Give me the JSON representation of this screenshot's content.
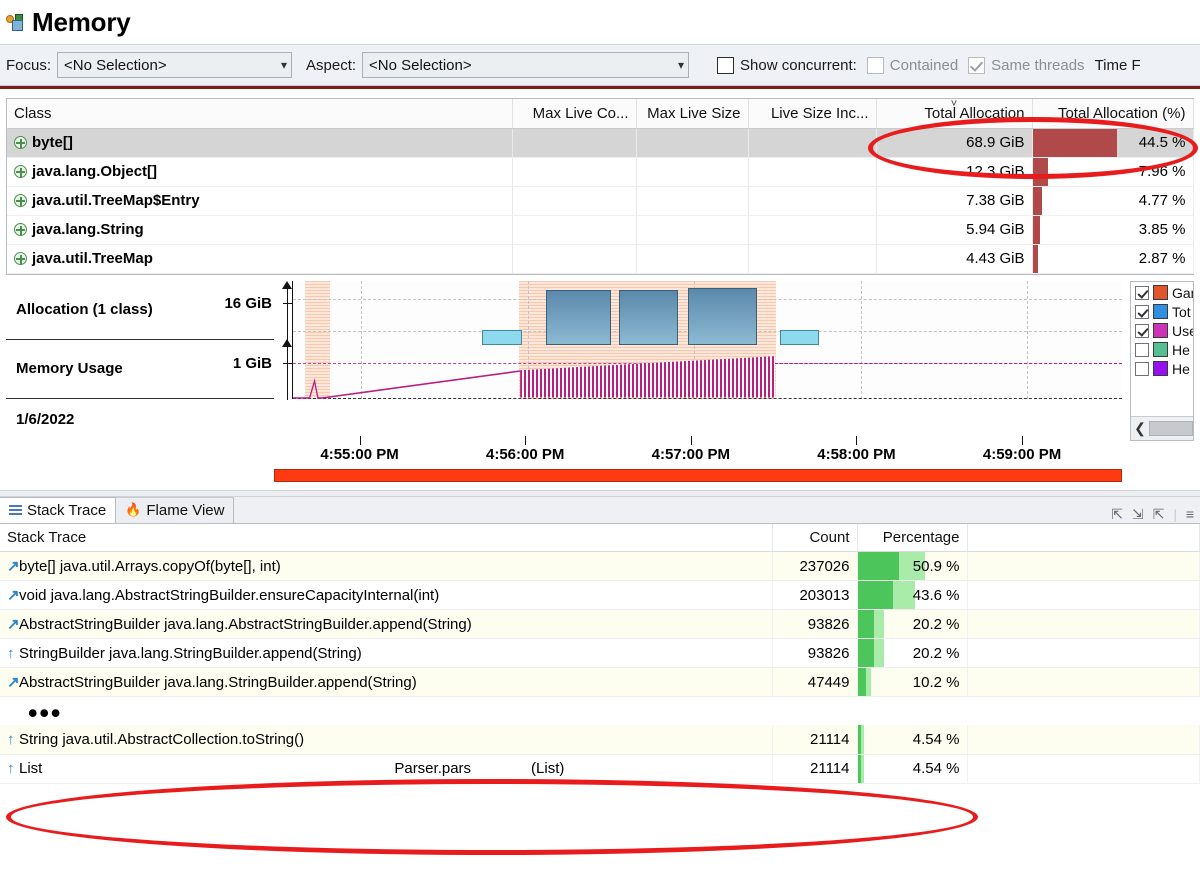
{
  "header": {
    "title": "Memory",
    "icon": "memory-icon"
  },
  "toolbar": {
    "focus_label": "Focus:",
    "focus_value": "<No Selection>",
    "aspect_label": "Aspect:",
    "aspect_value": "<No Selection>",
    "show_concurrent_label": "Show concurrent:",
    "contained_label": "Contained",
    "same_threads_label": "Same threads",
    "trailing_label": "Time F",
    "show_concurrent_checked": false,
    "contained_checked": false,
    "same_threads_checked": true
  },
  "class_table": {
    "columns": [
      "Class",
      "Max Live Co...",
      "Max Live Size",
      "Live Size Inc...",
      "Total Allocation",
      "Total Allocation (%)"
    ],
    "sorted_column": "Total Allocation",
    "sort_indicator": "˅",
    "rows": [
      {
        "class": "byte[]",
        "max_live_count": "",
        "max_live_size": "",
        "live_size_inc": "",
        "total_allocation": "68.9 GiB",
        "total_allocation_pct": "44.5 %",
        "pct_value": 44.5,
        "selected": true
      },
      {
        "class": "java.lang.Object[]",
        "max_live_count": "",
        "max_live_size": "",
        "live_size_inc": "",
        "total_allocation": "12.3 GiB",
        "total_allocation_pct": "7.96 %",
        "pct_value": 7.96,
        "selected": false
      },
      {
        "class": "java.util.TreeMap$Entry",
        "max_live_count": "",
        "max_live_size": "",
        "live_size_inc": "",
        "total_allocation": "7.38 GiB",
        "total_allocation_pct": "4.77 %",
        "pct_value": 4.77,
        "selected": false
      },
      {
        "class": "java.lang.String",
        "max_live_count": "",
        "max_live_size": "",
        "live_size_inc": "",
        "total_allocation": "5.94 GiB",
        "total_allocation_pct": "3.85 %",
        "pct_value": 3.85,
        "selected": false
      },
      {
        "class": "java.util.TreeMap",
        "max_live_count": "",
        "max_live_size": "",
        "live_size_inc": "",
        "total_allocation": "4.43 GiB",
        "total_allocation_pct": "2.87 %",
        "pct_value": 2.87,
        "selected": false
      }
    ]
  },
  "chart_data": {
    "type": "area",
    "title": "",
    "lanes": [
      {
        "label": "Allocation (1 class)",
        "axis_max_label": "16 GiB"
      },
      {
        "label": "Memory Usage",
        "axis_max_label": "1 GiB"
      }
    ],
    "date_label": "1/6/2022",
    "xlabel": "",
    "x_tick_labels": [
      "4:55:00 PM",
      "4:56:00 PM",
      "4:57:00 PM",
      "4:58:00 PM",
      "4:59:00 PM"
    ],
    "x_tick_positions_pct": [
      8.2,
      28.3,
      48.4,
      68.5,
      88.6
    ],
    "ylabels": [
      "16 GiB",
      "1 GiB"
    ],
    "grid": true,
    "selection_regions": [
      {
        "start_pct": 1.5,
        "end_pct": 4.5
      },
      {
        "start_pct": 27.3,
        "end_pct": 58.3
      }
    ],
    "allocation_boxes": [
      {
        "start_pct": 22.8,
        "end_pct": 27.6,
        "top_pct": 42,
        "height_pct": 13,
        "color": "#8fd9ee"
      },
      {
        "start_pct": 30.5,
        "end_pct": 38.3,
        "top_pct": 8,
        "height_pct": 47,
        "color": "#6d9cbd"
      },
      {
        "start_pct": 39.3,
        "end_pct": 46.5,
        "top_pct": 8,
        "height_pct": 47,
        "color": "#6d9cbd"
      },
      {
        "start_pct": 47.6,
        "end_pct": 56.0,
        "top_pct": 6,
        "height_pct": 49,
        "color": "#6d9cbd"
      },
      {
        "start_pct": 58.8,
        "end_pct": 63.5,
        "top_pct": 42,
        "height_pct": 13,
        "color": "#8fd9ee"
      }
    ],
    "memory_series_color": "#b81f80",
    "memory_ramp_start_pct": 3.5,
    "memory_ramp_end_pct": 27.4,
    "memory_oscillation_start_pct": 27.4,
    "memory_oscillation_end_pct": 58.2,
    "memory_plateau_pct": 32
  },
  "legend": {
    "items": [
      {
        "label": "Gar",
        "color": "#e0552a",
        "checked": true
      },
      {
        "label": "Tot",
        "color": "#2f8fe0",
        "checked": true
      },
      {
        "label": "Use",
        "color": "#cc34b8",
        "checked": true
      },
      {
        "label": "He",
        "color": "#57bd92",
        "checked": false
      },
      {
        "label": "He",
        "color": "#9610f0",
        "checked": false
      }
    ],
    "scroll_left_icon": "chevron-left-icon"
  },
  "bottom_panel": {
    "tabs": [
      {
        "label": "Stack Trace",
        "icon": "list-icon",
        "active": true
      },
      {
        "label": "Flame View",
        "icon": "flame-icon",
        "active": false
      }
    ],
    "tools": [
      "collapse-icon",
      "expand-icon",
      "collapse-all-icon",
      "tree-icon"
    ],
    "columns": [
      "Stack Trace",
      "Count",
      "Percentage"
    ],
    "rows": [
      {
        "icon": "branch-arrow-icon",
        "trace": "byte[] java.util.Arrays.copyOf(byte[], int)",
        "count": "237026",
        "percentage": "50.9 %",
        "pct_value": 50.9,
        "tint": true
      },
      {
        "icon": "branch-arrow-icon",
        "trace": "void java.lang.AbstractStringBuilder.ensureCapacityInternal(int)",
        "count": "203013",
        "percentage": "43.6 %",
        "pct_value": 43.6,
        "tint": false
      },
      {
        "icon": "branch-arrow-icon",
        "trace": "AbstractStringBuilder java.lang.AbstractStringBuilder.append(String)",
        "count": "93826",
        "percentage": "20.2 %",
        "pct_value": 20.2,
        "tint": true
      },
      {
        "icon": "up-arrow-icon",
        "trace": "StringBuilder java.lang.StringBuilder.append(String)",
        "count": "93826",
        "percentage": "20.2 %",
        "pct_value": 20.2,
        "tint": false
      },
      {
        "icon": "branch-arrow-icon",
        "trace": "AbstractStringBuilder java.lang.StringBuilder.append(String)",
        "count": "47449",
        "percentage": "10.2 %",
        "pct_value": 10.2,
        "tint": true
      }
    ],
    "ellipsis": "•••",
    "highlighted_rows": [
      {
        "icon": "up-arrow-icon",
        "trace": "String java.util.AbstractCollection.toString()",
        "trace_mid": "",
        "trace_tail": "",
        "count": "21114",
        "percentage": "4.54 %",
        "pct_value": 4.54,
        "tint": true
      },
      {
        "icon": "up-arrow-icon",
        "trace": "List",
        "trace_mid": "Parser.pars",
        "trace_tail": "(List)",
        "count": "21114",
        "percentage": "4.54 %",
        "pct_value": 4.54,
        "tint": false
      }
    ]
  },
  "annotations": {
    "color": "#e81c1c",
    "ellipses": [
      "total-allocation-column-highlight",
      "bottom-rows-highlight"
    ]
  }
}
